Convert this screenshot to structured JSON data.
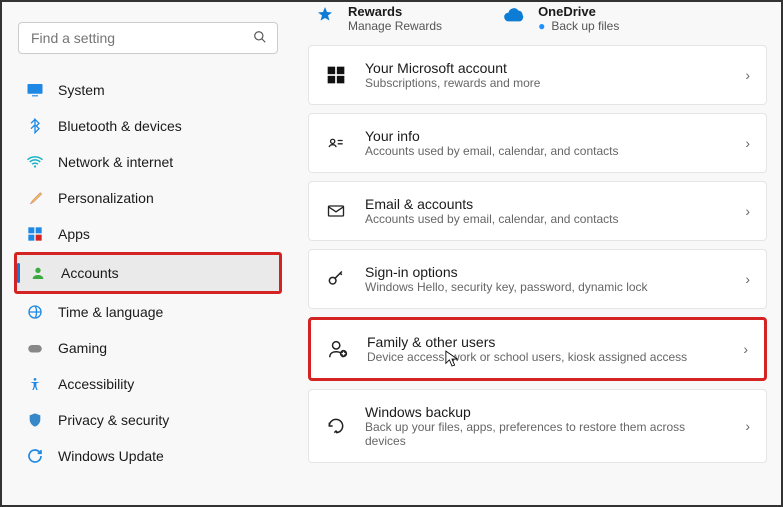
{
  "search": {
    "placeholder": "Find a setting"
  },
  "sidebar": {
    "items": [
      {
        "label": "System"
      },
      {
        "label": "Bluetooth & devices"
      },
      {
        "label": "Network & internet"
      },
      {
        "label": "Personalization"
      },
      {
        "label": "Apps"
      },
      {
        "label": "Accounts"
      },
      {
        "label": "Time & language"
      },
      {
        "label": "Gaming"
      },
      {
        "label": "Accessibility"
      },
      {
        "label": "Privacy & security"
      },
      {
        "label": "Windows Update"
      }
    ]
  },
  "top": {
    "rewards": {
      "title": "Rewards",
      "sub": "Manage Rewards"
    },
    "onedrive": {
      "title": "OneDrive",
      "sub": "Back up files"
    }
  },
  "cards": [
    {
      "title": "Your Microsoft account",
      "sub": "Subscriptions, rewards and more"
    },
    {
      "title": "Your info",
      "sub": "Accounts used by email, calendar, and contacts"
    },
    {
      "title": "Email & accounts",
      "sub": "Accounts used by email, calendar, and contacts"
    },
    {
      "title": "Sign-in options",
      "sub": "Windows Hello, security key, password, dynamic lock"
    },
    {
      "title": "Family & other users",
      "sub": "Device access, work or school users, kiosk assigned access"
    },
    {
      "title": "Windows backup",
      "sub": "Back up your files, apps, preferences to restore them across devices"
    }
  ]
}
